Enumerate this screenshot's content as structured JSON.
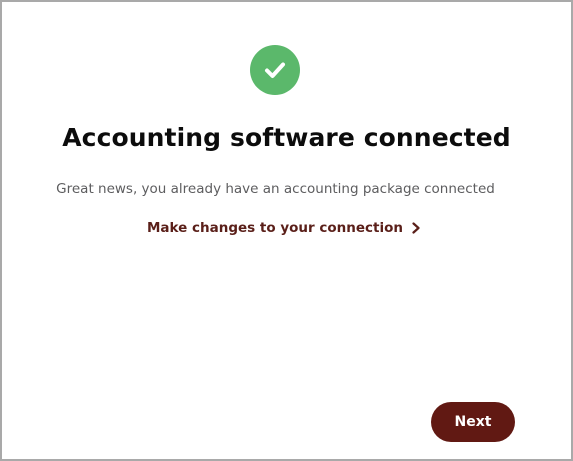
{
  "dialog": {
    "icon": "check-circle-icon",
    "title": "Accounting software connected",
    "message": "Great news, you already have an accounting package connected",
    "link_label": "Make changes to your connection",
    "link_icon": "chevron-right-icon",
    "next_label": "Next"
  },
  "colors": {
    "success_green": "#5bb86b",
    "brand_maroon": "#611913",
    "link_maroon": "#5a1f19"
  }
}
